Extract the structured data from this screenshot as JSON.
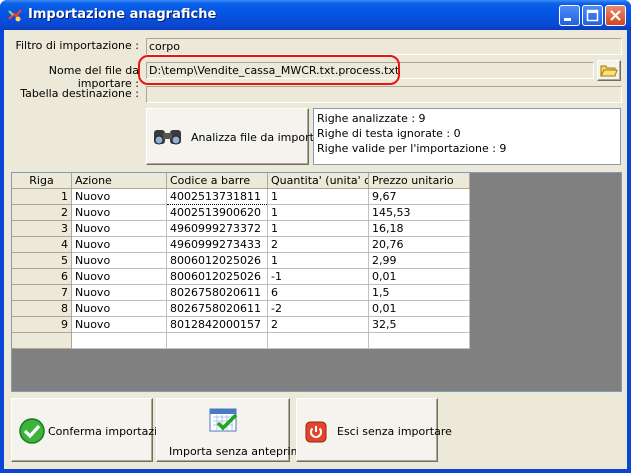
{
  "window": {
    "title": "Importazione anagrafiche"
  },
  "form": {
    "filtro_label": "Filtro di importazione :",
    "filtro_value": "corpo",
    "file_label": "Nome del file da importare :",
    "file_value": "D:\\temp\\Vendite_cassa_MWCR.txt.process.txt",
    "tabella_label": "Tabella destinazione :",
    "tabella_value": ""
  },
  "analyze_button": {
    "label": "Analizza file da importare",
    "icon": "binoculars-icon"
  },
  "summary": [
    "Righe analizzate : 9",
    "Righe di testa ignorate : 0",
    "Righe valide per l'importazione : 9"
  ],
  "grid": {
    "columns": [
      "Riga",
      "Azione",
      "Codice a barre",
      "Quantita' (unita' di",
      "Prezzo unitario"
    ],
    "rows": [
      [
        "1",
        "Nuovo",
        "4002513731811",
        "1",
        "9,67"
      ],
      [
        "2",
        "Nuovo",
        "4002513900620",
        "1",
        "145,53"
      ],
      [
        "3",
        "Nuovo",
        "4960999273372",
        "1",
        "16,18"
      ],
      [
        "4",
        "Nuovo",
        "4960999273433",
        "2",
        "20,76"
      ],
      [
        "5",
        "Nuovo",
        "8006012025026",
        "1",
        "2,99"
      ],
      [
        "6",
        "Nuovo",
        "8006012025026",
        "-1",
        "0,01"
      ],
      [
        "7",
        "Nuovo",
        "8026758020611",
        "6",
        "1,5"
      ],
      [
        "8",
        "Nuovo",
        "8026758020611",
        "-2",
        "0,01"
      ],
      [
        "9",
        "Nuovo",
        "8012842000157",
        "2",
        "32,5"
      ],
      [
        "",
        "",
        "",
        "",
        ""
      ]
    ]
  },
  "buttons": {
    "confirm": "Conferma importazione",
    "import_no_preview": "Importa senza anteprima",
    "exit": "Esci senza importare"
  }
}
